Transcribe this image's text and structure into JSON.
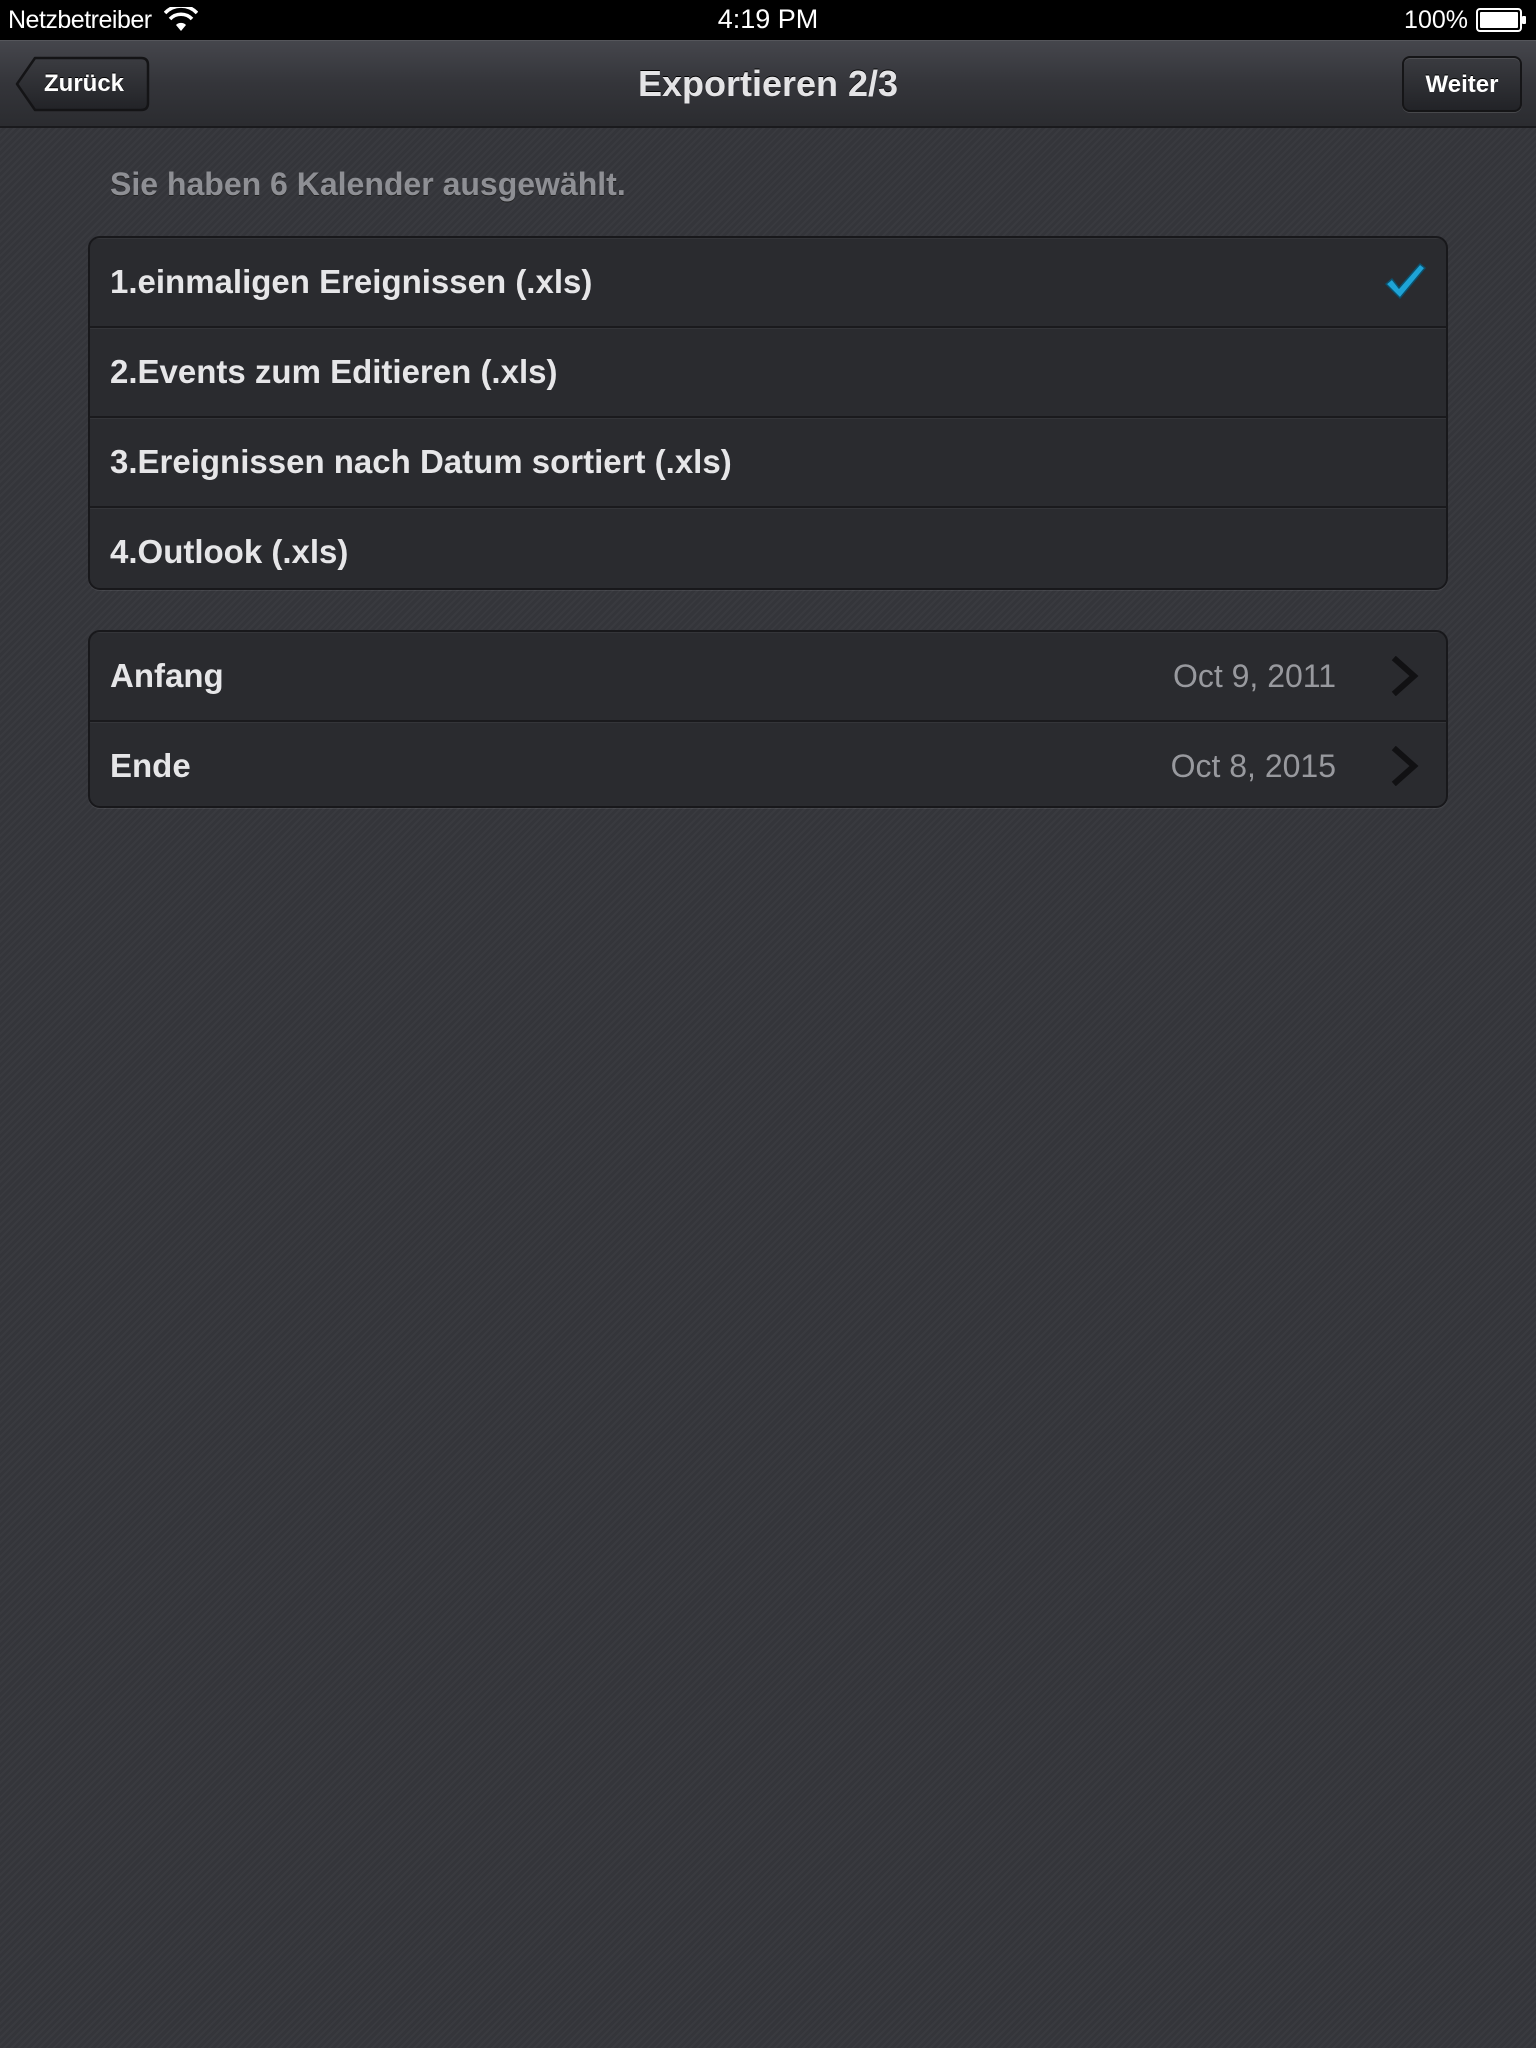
{
  "status_bar": {
    "carrier": "Netzbetreiber",
    "time": "4:19 PM",
    "battery": "100%"
  },
  "nav": {
    "back_label": "Zurück",
    "title": "Exportieren 2/3",
    "next_label": "Weiter"
  },
  "info_text": "Sie haben 6 Kalender ausgewählt.",
  "formats": [
    {
      "label": "1.einmaligen Ereignissen (.xls)",
      "selected": true
    },
    {
      "label": "2.Events zum Editieren (.xls)",
      "selected": false
    },
    {
      "label": "3.Ereignissen nach Datum sortiert (.xls)",
      "selected": false
    },
    {
      "label": "4.Outlook (.xls)",
      "selected": false
    }
  ],
  "dates": [
    {
      "label": "Anfang",
      "value": "Oct 9, 2011"
    },
    {
      "label": "Ende",
      "value": "Oct 8, 2015"
    }
  ],
  "colors": {
    "checkmark": "#1ea3d6",
    "background": "#35363b"
  }
}
